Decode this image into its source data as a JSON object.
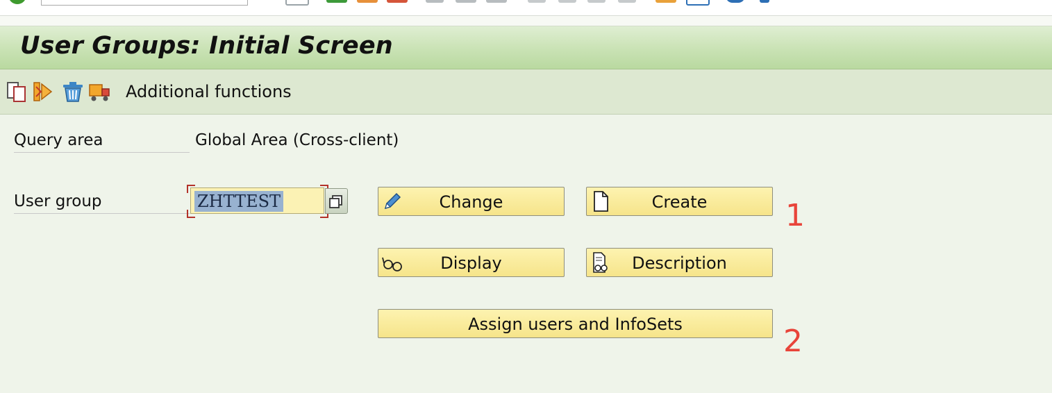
{
  "window": {
    "title": "User Groups: Initial Screen"
  },
  "toolbar": {
    "icons": [
      "copy-icon",
      "rename-icon",
      "delete-icon",
      "transport-icon"
    ],
    "additional_functions_label": "Additional functions"
  },
  "form": {
    "query_area_label": "Query area",
    "query_area_value": "Global Area (Cross-client)",
    "user_group_label": "User group",
    "user_group_value": "ZHTTEST"
  },
  "buttons": {
    "change_label": "Change",
    "create_label": "Create",
    "display_label": "Display",
    "description_label": "Description",
    "assign_label": "Assign users and InfoSets"
  },
  "annotations": {
    "marker_1": "1",
    "marker_2": "2"
  },
  "colors": {
    "title_bar": "#c9e2b4",
    "button_fill": "#f6e48a",
    "input_fill": "#fbf2b4",
    "selection": "#98b2d0",
    "annotation": "#e8443a"
  }
}
